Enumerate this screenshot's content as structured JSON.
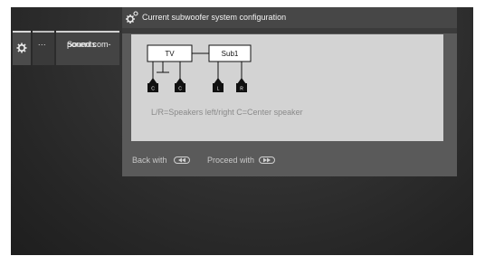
{
  "menu": {
    "tabs": [
      {
        "label": "...",
        "icon": "gear-icon"
      },
      {
        "label": "Sound com- ponents"
      }
    ],
    "dots_label": "...",
    "sound_label": "Sound com-\nponents"
  },
  "panel": {
    "title": "Current subwoofer system configuration",
    "title_icon": "gears-icon"
  },
  "diagram": {
    "nodes": [
      {
        "label": "TV"
      },
      {
        "label": "Sub1"
      }
    ],
    "speakers": [
      {
        "label": "C",
        "connected_to": "TV"
      },
      {
        "label": "C",
        "connected_to": "TV"
      },
      {
        "label": "L",
        "connected_to": "Sub1"
      },
      {
        "label": "R",
        "connected_to": "Sub1"
      }
    ],
    "legend": "L/R=Speakers left/right   C=Center speaker"
  },
  "footer": {
    "back_label": "Back with",
    "back_key": "rewind-key-icon",
    "proceed_label": "Proceed with",
    "proceed_key": "fast-forward-key-icon"
  }
}
